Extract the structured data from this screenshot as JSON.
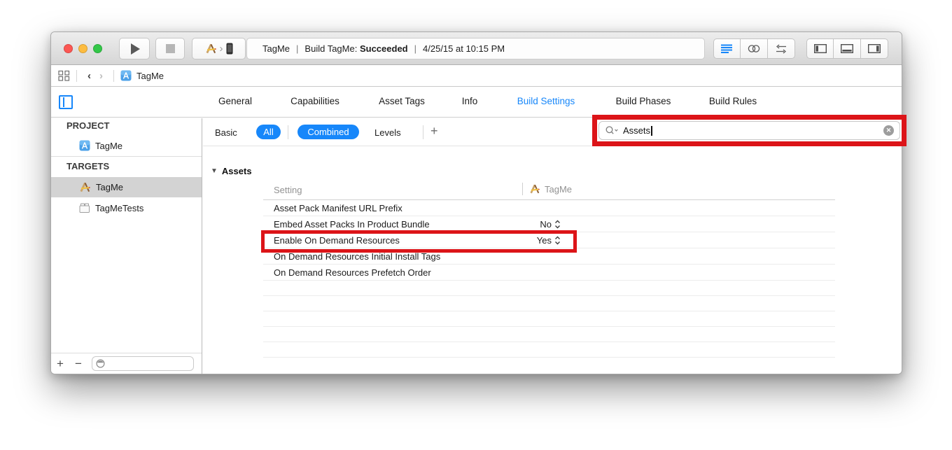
{
  "toolbar": {
    "status_project": "TagMe",
    "status_sep1": "|",
    "status_build_label": "Build TagMe:",
    "status_build_result": "Succeeded",
    "status_sep2": "|",
    "status_time": "4/25/15 at 10:15 PM"
  },
  "jumpbar": {
    "back_glyph": "‹",
    "forward_glyph": "›",
    "doc_label": "TagMe"
  },
  "editor_tabs": [
    "General",
    "Capabilities",
    "Asset Tags",
    "Info",
    "Build Settings",
    "Build Phases",
    "Build Rules"
  ],
  "selected_tab": "Build Settings",
  "filterbar": {
    "basic": "Basic",
    "all": "All",
    "combined": "Combined",
    "levels": "Levels",
    "add": "+"
  },
  "search": {
    "value": "Assets",
    "clear_glyph": "✕"
  },
  "sidebar": {
    "project_header": "PROJECT",
    "project_item": "TagMe",
    "targets_header": "TARGETS",
    "target_app": "TagMe",
    "target_tests": "TagMeTests",
    "add_glyph": "+",
    "remove_glyph": "−"
  },
  "settings": {
    "section_title": "Assets",
    "disclosure_glyph": "▼",
    "col_setting": "Setting",
    "col_target": "TagMe",
    "rows": [
      {
        "name": "Asset Pack Manifest URL Prefix",
        "value": ""
      },
      {
        "name": "Embed Asset Packs In Product Bundle",
        "value": "No"
      },
      {
        "name": "Enable On Demand Resources",
        "value": "Yes"
      },
      {
        "name": "On Demand Resources Initial Install Tags",
        "value": ""
      },
      {
        "name": "On Demand Resources Prefetch Order",
        "value": ""
      }
    ]
  },
  "icons": {
    "scheme_chevron": "›"
  },
  "colors": {
    "accent_blue": "#1787fa",
    "highlight_red": "#dc1418",
    "traffic_red": "#fc5753",
    "traffic_yellow": "#fdbc40",
    "traffic_green": "#33c748",
    "selected_row_gray": "#d3d3d3"
  }
}
